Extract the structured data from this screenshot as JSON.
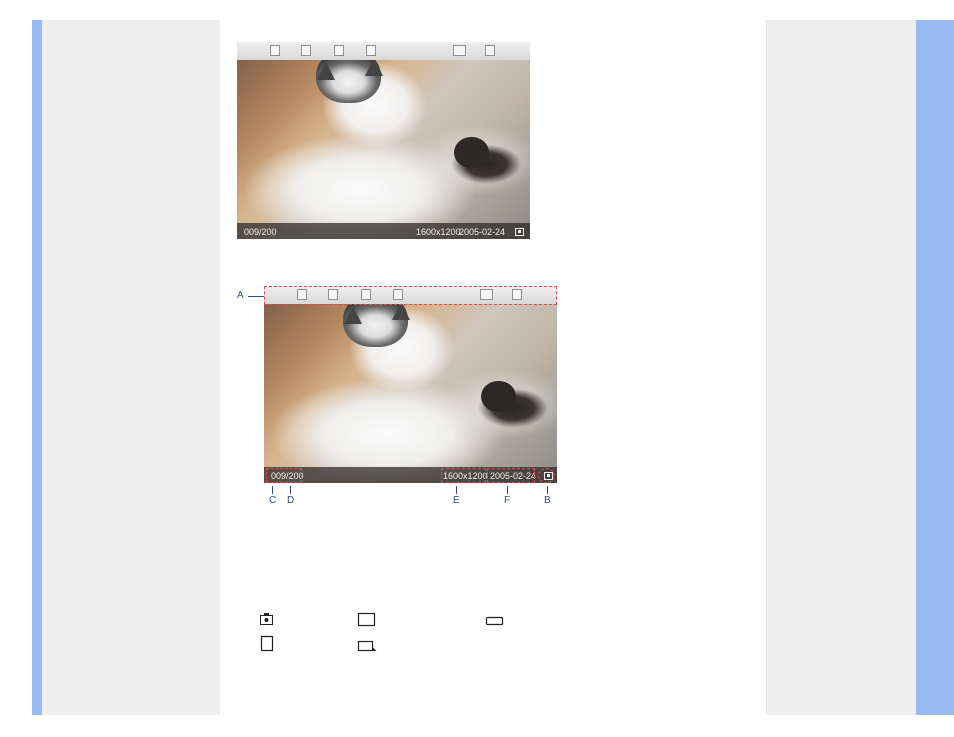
{
  "photo_top": {
    "counter": "009/200",
    "resolution": "1600x1200",
    "date": "2005-02-24"
  },
  "photo_bottom": {
    "counter": "009/200",
    "resolution": "1600x1200",
    "date": "2005-02-24"
  },
  "callouts": {
    "A": "A",
    "B": "B",
    "C": "C",
    "D": "D",
    "E": "E",
    "F": "F"
  },
  "legend_icons": [
    "camera-card-icon",
    "screen-rect-icon",
    "slim-rect-icon",
    "sd-card-icon",
    "rect-arrow-icon"
  ],
  "colors": {
    "accent_blue": "#99bbf2",
    "panel_gray": "#efefef",
    "annotation_red": "#e04a4a",
    "callout_blue": "#2c4f8e"
  }
}
